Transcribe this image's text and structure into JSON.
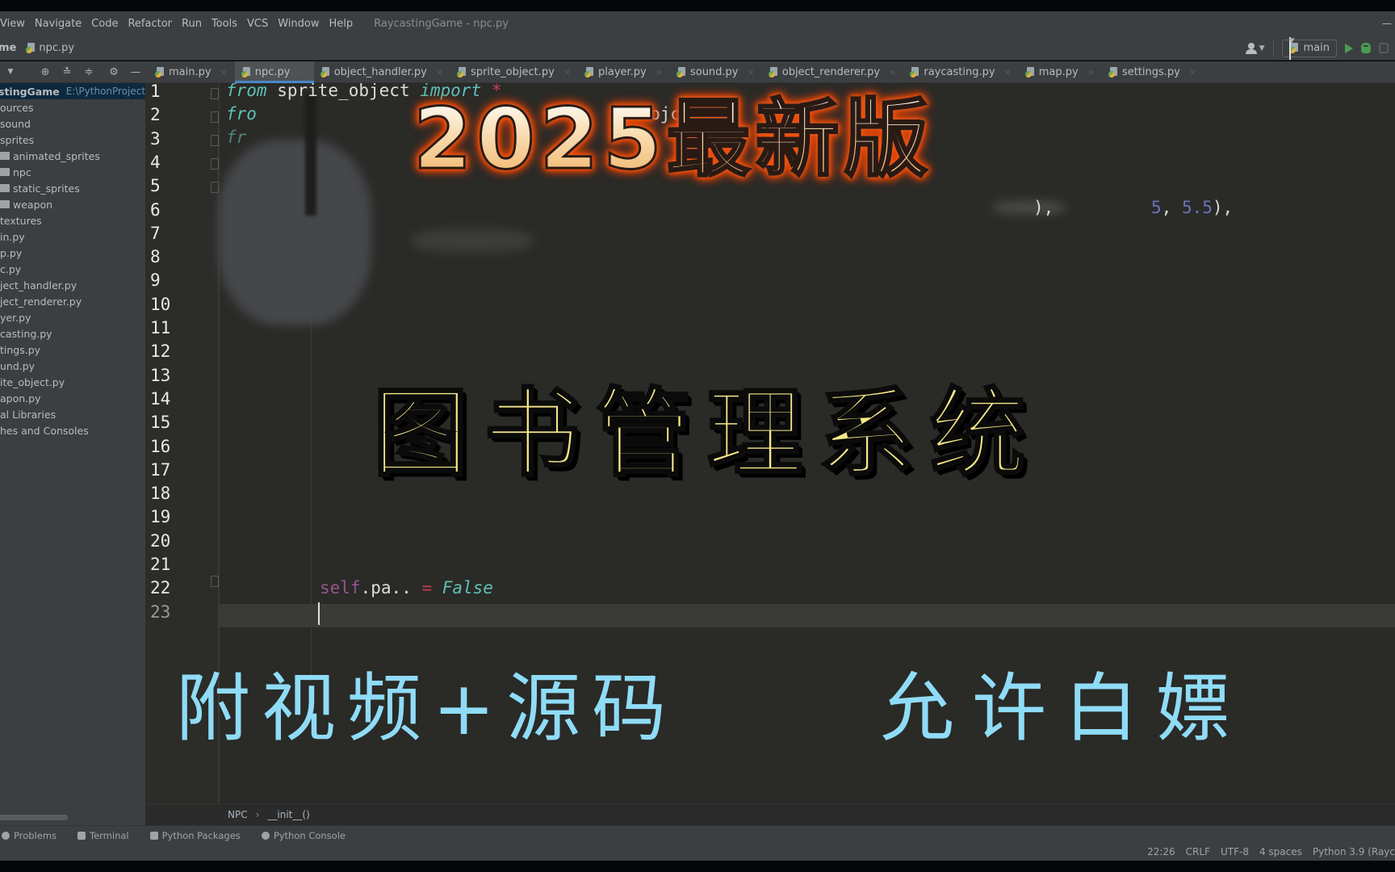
{
  "window": {
    "title": "RaycastingGame - npc.py"
  },
  "menu": {
    "items": [
      "View",
      "Navigate",
      "Code",
      "Refactor",
      "Run",
      "Tools",
      "VCS",
      "Window",
      "Help"
    ]
  },
  "navbar": {
    "project_crumb": "me",
    "file_crumb": "npc.py",
    "run_config": "main"
  },
  "tabs": [
    {
      "label": "main.py",
      "active": false
    },
    {
      "label": "npc.py",
      "active": true
    },
    {
      "label": "object_handler.py",
      "active": false
    },
    {
      "label": "sprite_object.py",
      "active": false
    },
    {
      "label": "player.py",
      "active": false
    },
    {
      "label": "sound.py",
      "active": false
    },
    {
      "label": "object_renderer.py",
      "active": false
    },
    {
      "label": "raycasting.py",
      "active": false
    },
    {
      "label": "map.py",
      "active": false
    },
    {
      "label": "settings.py",
      "active": false
    }
  ],
  "project": {
    "root_name": "stingGame",
    "root_path": "E:\\PythonProjects\\",
    "nodes": [
      {
        "label": "ources",
        "folder": false,
        "indent": 0
      },
      {
        "label": "sound",
        "folder": false,
        "indent": 0
      },
      {
        "label": "sprites",
        "folder": false,
        "indent": 0
      },
      {
        "label": "animated_sprites",
        "folder": true,
        "indent": 1
      },
      {
        "label": "npc",
        "folder": true,
        "indent": 1
      },
      {
        "label": "static_sprites",
        "folder": true,
        "indent": 1
      },
      {
        "label": "weapon",
        "folder": true,
        "indent": 1
      },
      {
        "label": "textures",
        "folder": false,
        "indent": 0
      },
      {
        "label": "in.py",
        "folder": false,
        "indent": 0
      },
      {
        "label": "p.py",
        "folder": false,
        "indent": 0
      },
      {
        "label": "c.py",
        "folder": false,
        "indent": 0
      },
      {
        "label": "ject_handler.py",
        "folder": false,
        "indent": 0
      },
      {
        "label": "ject_renderer.py",
        "folder": false,
        "indent": 0
      },
      {
        "label": "yer.py",
        "folder": false,
        "indent": 0
      },
      {
        "label": "casting.py",
        "folder": false,
        "indent": 0
      },
      {
        "label": "tings.py",
        "folder": false,
        "indent": 0
      },
      {
        "label": "und.py",
        "folder": false,
        "indent": 0
      },
      {
        "label": "ite_object.py",
        "folder": false,
        "indent": 0
      },
      {
        "label": "apon.py",
        "folder": false,
        "indent": 0
      },
      {
        "label": "al Libraries",
        "folder": false,
        "indent": 0
      },
      {
        "label": "hes and Consoles",
        "folder": false,
        "indent": 0
      }
    ]
  },
  "editor": {
    "line_count": 23,
    "current_line": 23,
    "line1": {
      "kw_from": "from",
      "module": " sprite_object ",
      "kw_import": "import",
      "star": " *"
    },
    "line2_partial": "fro",
    "line3_partial": "fr",
    "line2_fragment": "bjc",
    "line6": {
      "frag1": "),",
      "n1": "5",
      "sep": ", ",
      "n2": "5.5",
      "tail": "),"
    },
    "line22": {
      "self": "self",
      "attr": ".pa..",
      "eq": " = ",
      "value": "False"
    }
  },
  "overlay": {
    "title_top": "2025最新版",
    "title_main": "图书管理系统",
    "sub_left": "附视频+源码",
    "sub_right": "允许白嫖"
  },
  "editor_breadcrumb": {
    "class": "NPC",
    "method": "__init__()"
  },
  "tool_windows": [
    "Problems",
    "Terminal",
    "Python Packages",
    "Python Console"
  ],
  "status": {
    "position": "22:26",
    "line_sep": "CRLF",
    "encoding": "UTF-8",
    "indent": "4 spaces",
    "interpreter": "Python 3.9 (Rayc"
  },
  "colors": {
    "accent_tab": "#4a88c7",
    "title_top_glow": "#e84a0a",
    "title_main": "#f7e88a",
    "subtitle": "#8fdcf7"
  }
}
